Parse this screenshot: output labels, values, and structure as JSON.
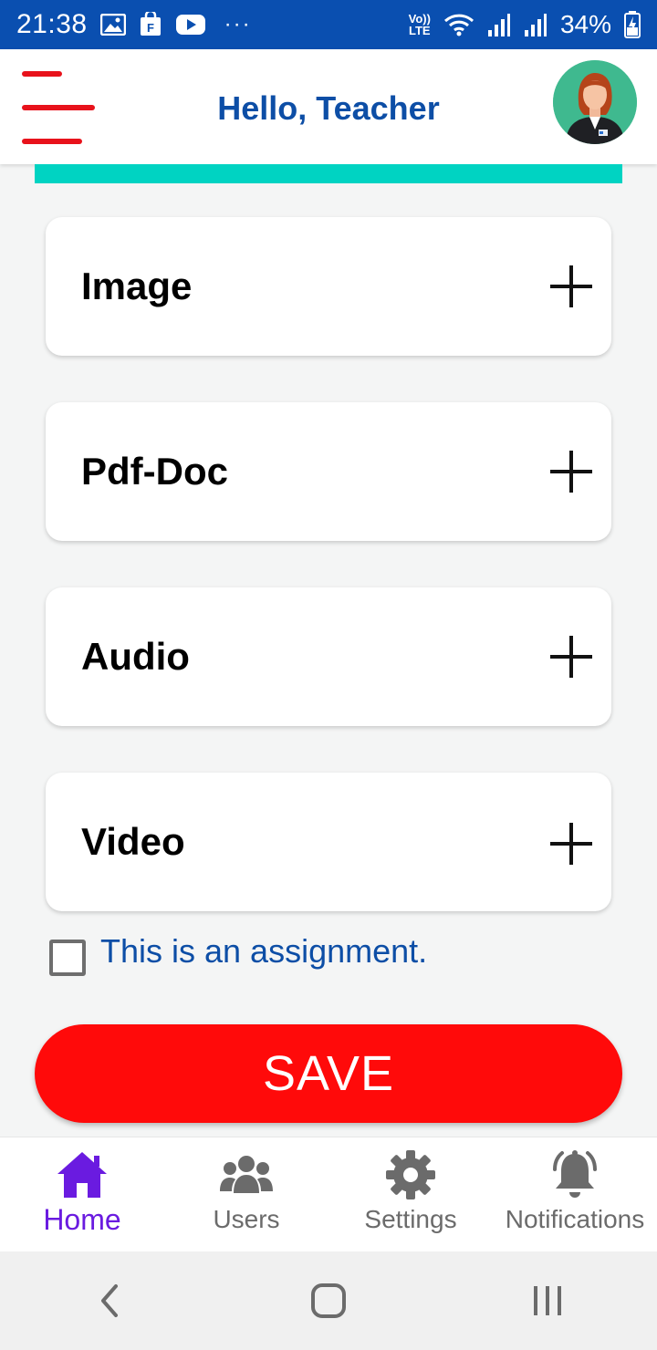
{
  "status_bar": {
    "time": "21:38",
    "more": "···",
    "network_top": "Vo))",
    "network_bottom": "LTE",
    "battery": "34%"
  },
  "header": {
    "title": "Hello, Teacher"
  },
  "cards": [
    {
      "label": "Image"
    },
    {
      "label": "Pdf-Doc"
    },
    {
      "label": "Audio"
    },
    {
      "label": "Video"
    }
  ],
  "assignment": {
    "label": "This is an assignment.",
    "checked": false
  },
  "save": {
    "label": "SAVE"
  },
  "bottom_nav": {
    "items": [
      {
        "label": "Home",
        "icon": "home-icon",
        "active": true
      },
      {
        "label": "Users",
        "icon": "users-icon",
        "active": false
      },
      {
        "label": "Settings",
        "icon": "gear-icon",
        "active": false
      },
      {
        "label": "Notifications",
        "icon": "bell-icon",
        "active": false
      }
    ]
  },
  "colors": {
    "status_bar": "#0a4fb0",
    "title": "#0d4ea6",
    "menu": "#e8121b",
    "accent_strip": "#00d3c2",
    "save": "#ff0a0a",
    "nav_active": "#6a1be0",
    "nav_inactive": "#6b6b6b"
  }
}
